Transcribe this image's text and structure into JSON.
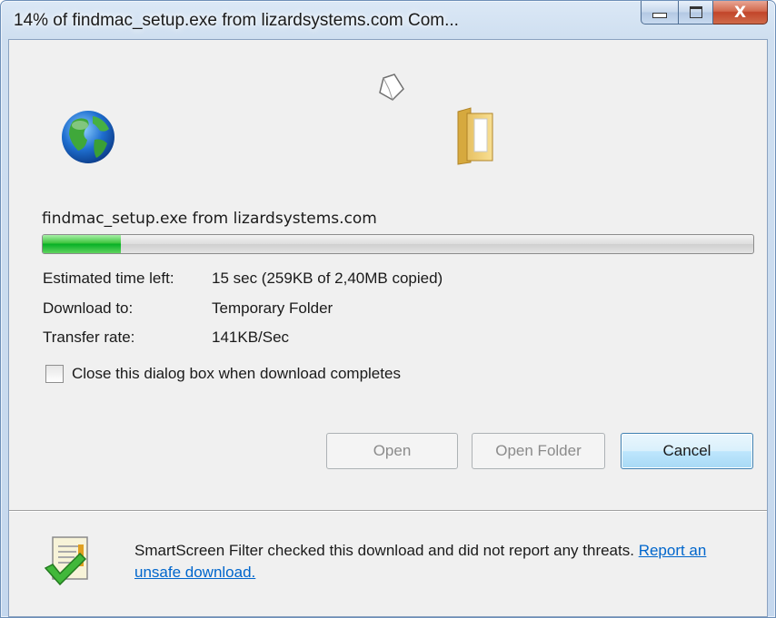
{
  "window": {
    "title": "14% of findmac_setup.exe from lizardsystems.com Com...",
    "close_glyph": "X"
  },
  "icons": {
    "source": "globe-icon",
    "transfer": "paper-icon",
    "destination": "folder-icon",
    "smartscreen": "checked-document-icon"
  },
  "download": {
    "filename": "findmac_setup.exe from lizardsystems.com",
    "progress_fraction": 0.11,
    "labels": {
      "time_left": "Estimated time left:",
      "download_to": "Download to:",
      "transfer_rate": "Transfer rate:"
    },
    "values": {
      "time_left": "15 sec (259KB of 2,40MB copied)",
      "download_to": "Temporary Folder",
      "transfer_rate": "141KB/Sec"
    },
    "close_checkbox_label": "Close this dialog box when download completes",
    "close_checkbox_checked": false
  },
  "buttons": {
    "open": "Open",
    "open_folder": "Open Folder",
    "cancel": "Cancel"
  },
  "smartscreen": {
    "text": "SmartScreen Filter checked this download and did not report any threats. ",
    "link": "Report an unsafe download."
  },
  "colors": {
    "progress": "#06b025",
    "link": "#0066cc"
  }
}
